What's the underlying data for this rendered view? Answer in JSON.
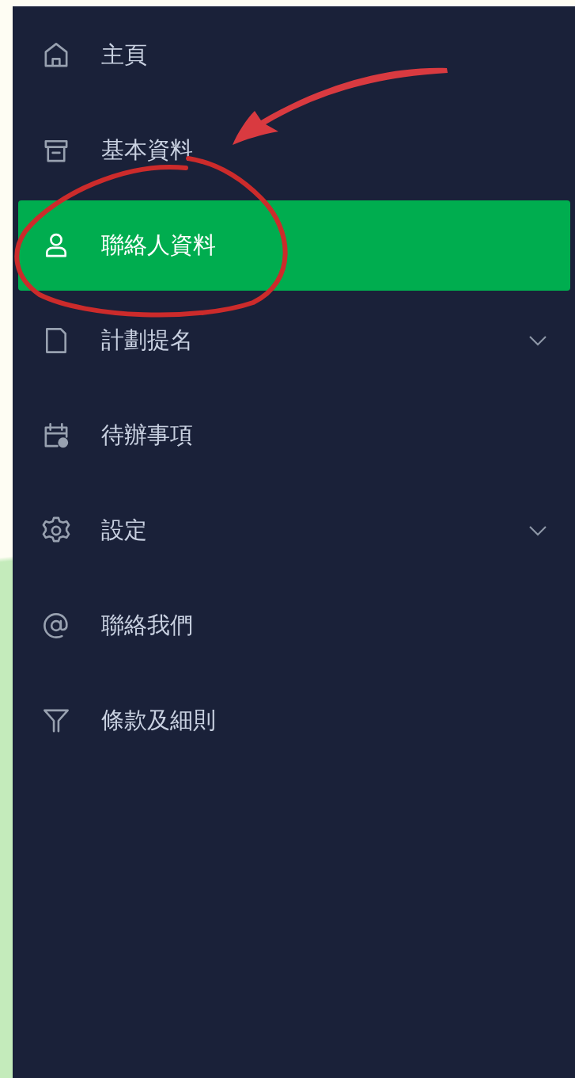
{
  "sidebar": {
    "items": [
      {
        "label": "主頁",
        "selected": false,
        "expandable": false
      },
      {
        "label": "基本資料",
        "selected": false,
        "expandable": false
      },
      {
        "label": "聯絡人資料",
        "selected": true,
        "expandable": false
      },
      {
        "label": "計劃提名",
        "selected": false,
        "expandable": true
      },
      {
        "label": "待辦事項",
        "selected": false,
        "expandable": false
      },
      {
        "label": "設定",
        "selected": false,
        "expandable": true
      },
      {
        "label": "聯絡我們",
        "selected": false,
        "expandable": false
      },
      {
        "label": "條款及細則",
        "selected": false,
        "expandable": false
      }
    ]
  }
}
